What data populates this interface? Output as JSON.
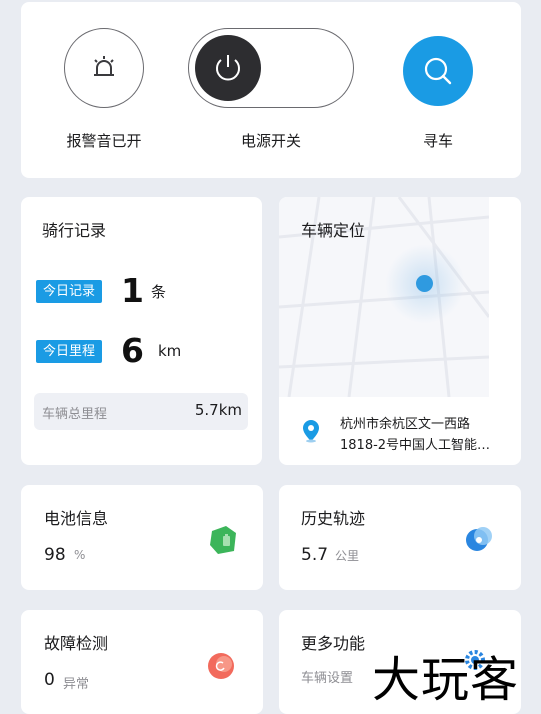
{
  "controls": {
    "alarm_label": "报警音已开",
    "power_label": "电源开关",
    "find_label": "寻车"
  },
  "ride_record": {
    "title": "骑行记录",
    "today_records_tag": "今日记录",
    "today_records_value": "1",
    "today_records_unit": "条",
    "today_mileage_tag": "今日里程",
    "today_mileage_value": "6",
    "today_mileage_unit": "km",
    "total_mileage_label": "车辆总里程",
    "total_mileage_value": "5.7km"
  },
  "location": {
    "title": "车辆定位",
    "address_line1": "杭州市余杭区文一西路",
    "address_line2": "1818-2号中国人工智能…"
  },
  "battery": {
    "title": "电池信息",
    "value": "98",
    "unit": "%"
  },
  "history": {
    "title": "历史轨迹",
    "value": "5.7",
    "unit": "公里"
  },
  "fault": {
    "title": "故障检测",
    "value": "0",
    "status": "异常"
  },
  "more": {
    "title": "更多功能",
    "subtitle": "车辆设置"
  },
  "watermark": "大玩客",
  "colors": {
    "accent": "#1a9be4",
    "background": "#e9ecf2",
    "battery_green": "#3cb55a",
    "fault_red": "#f26a5c"
  }
}
